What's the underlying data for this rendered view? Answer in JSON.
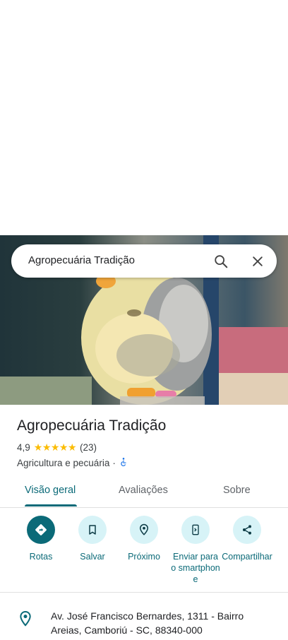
{
  "search": {
    "query": "Agropecuária Tradição"
  },
  "place": {
    "name": "Agropecuária Tradição",
    "rating": "4,9",
    "stars": "★★★★★",
    "reviews": "(23)",
    "category": "Agricultura e pecuária",
    "separator": "·",
    "accessible_icon": "wheelchair-icon"
  },
  "tabs": [
    {
      "label": "Visão geral",
      "active": true
    },
    {
      "label": "Avaliações",
      "active": false
    },
    {
      "label": "Sobre",
      "active": false
    }
  ],
  "actions": [
    {
      "label": "Rotas",
      "icon": "directions-icon"
    },
    {
      "label": "Salvar",
      "icon": "bookmark-icon"
    },
    {
      "label": "Próximo",
      "icon": "nearby-icon"
    },
    {
      "label": "Enviar para o smartphone",
      "icon": "send-to-phone-icon"
    },
    {
      "label": "Compartilhar",
      "icon": "share-icon"
    }
  ],
  "address": {
    "text": "Av. José Francisco Bernardes, 1311 - Bairro Areias, Camboriú - SC, 88340-000",
    "icon": "location-pin-icon"
  },
  "colors": {
    "accent": "#0b6a78",
    "action_bg": "#d7f3f7",
    "star": "#fbbc04"
  }
}
